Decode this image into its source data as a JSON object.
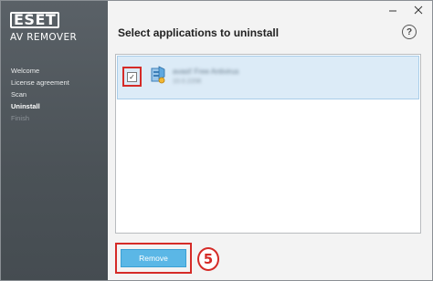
{
  "app": {
    "brand": "ESET",
    "product": "AV REMOVER"
  },
  "sidebar": {
    "items": [
      {
        "label": "Welcome",
        "state": "done"
      },
      {
        "label": "License agreement",
        "state": "done"
      },
      {
        "label": "Scan",
        "state": "done"
      },
      {
        "label": "Uninstall",
        "state": "active"
      },
      {
        "label": "Finish",
        "state": "disabled"
      }
    ]
  },
  "window_controls": {
    "minimize_icon": "minimize-icon",
    "close_icon": "close-icon"
  },
  "header": {
    "title": "Select applications to uninstall",
    "help_label": "?"
  },
  "applications": [
    {
      "name": "avast! Free Antivirus",
      "version": "10.0.2208",
      "checked": true
    }
  ],
  "footer": {
    "remove_label": "Remove",
    "step_number": "5"
  },
  "colors": {
    "sidebar": "#4f565b",
    "highlight": "#d52b27",
    "primary_button": "#5bb7e6",
    "selected_row": "#dcebf7"
  }
}
